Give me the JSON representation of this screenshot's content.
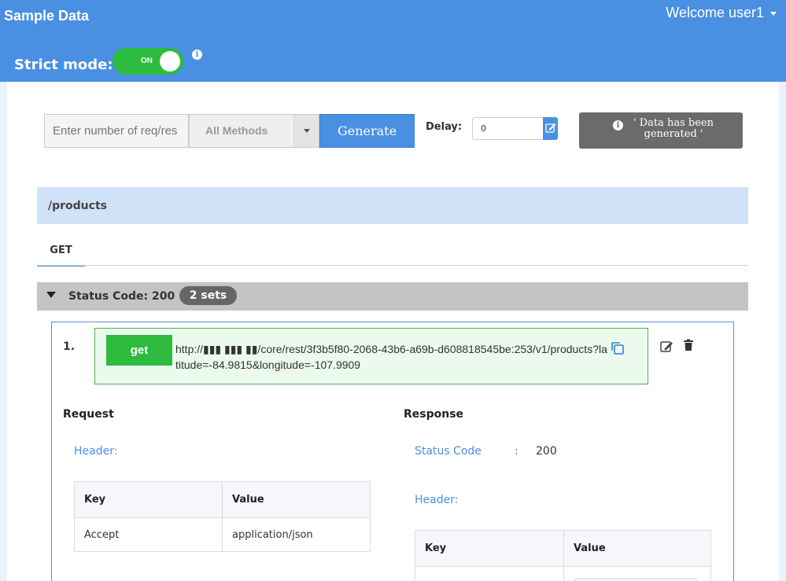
{
  "app": {
    "title": "Sample Data",
    "welcome": "Welcome user1"
  },
  "strict_mode": {
    "label": "Strict mode:",
    "state": "ON"
  },
  "controls": {
    "req_placeholder": "Enter number of req/res",
    "method_selected": "All Methods",
    "generate_label": "Generate",
    "delay_label": "Delay:",
    "delay_value": "0",
    "message": "' Data has been generated '"
  },
  "endpoint": {
    "path": "/products",
    "tabs": [
      {
        "label": "GET"
      }
    ],
    "status_code_label": "Status Code: 200",
    "sets_badge": "2 sets"
  },
  "set": {
    "number": "1.",
    "method": "get",
    "url": "http://▮▮▮ ▮▮▮ ▮▮/core/rest/3f3b5f80-2068-43b6-a69b-d608818545be:253/v1/products?latitude=-84.9815&longitude=-107.9909"
  },
  "request": {
    "title": "Request",
    "header_label": "Header:",
    "columns": [
      "Key",
      "Value"
    ],
    "rows": [
      {
        "key": "Accept",
        "value": "application/json"
      }
    ]
  },
  "response": {
    "title": "Response",
    "status_code_label": "Status Code",
    "separator": ":",
    "status_code_value": "200",
    "header_label": "Header:",
    "columns": [
      "Key",
      "Value"
    ]
  },
  "colors": {
    "primary": "#4a90e2",
    "success": "#2dbb3d",
    "path_bar": "#cfe2f8",
    "status_bar": "#c4c4c4"
  }
}
